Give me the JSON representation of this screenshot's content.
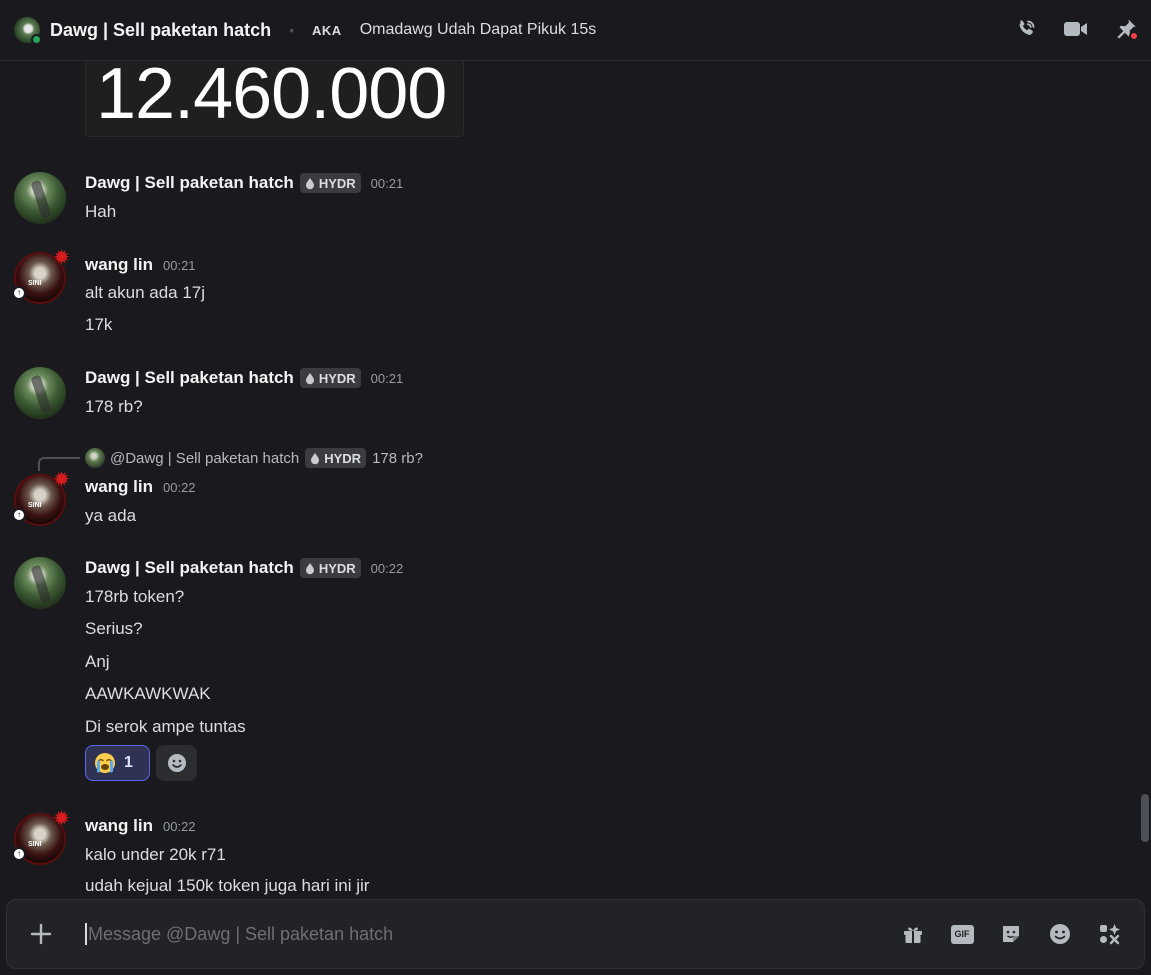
{
  "header": {
    "title": "Dawg | Sell paketan hatch",
    "separator": "•",
    "aka_label": "AKA",
    "nickname": "Omadawg Udah Dapat Pikuk 15s",
    "icons": [
      "phone-call-icon",
      "video-call-icon",
      "pin-icon"
    ]
  },
  "image_text": "12.460.000",
  "messages": [
    {
      "author": "Dawg | Sell paketan hatch",
      "tag": "HYDR",
      "time": "00:21",
      "lines": [
        "Hah"
      ]
    },
    {
      "author": "wang lin",
      "time": "00:21",
      "lines": [
        "alt akun ada 17j",
        "17k"
      ]
    },
    {
      "author": "Dawg | Sell paketan hatch",
      "tag": "HYDR",
      "time": "00:21",
      "lines": [
        "178 rb?"
      ]
    },
    {
      "author": "wang lin",
      "time": "00:22",
      "lines": [
        "ya ada"
      ],
      "reply": {
        "author": "@Dawg | Sell paketan hatch",
        "tag": "HYDR",
        "text": "178 rb?"
      }
    },
    {
      "author": "Dawg | Sell paketan hatch",
      "tag": "HYDR",
      "time": "00:22",
      "lines": [
        "178rb token?",
        "Serius?",
        "Anj",
        "AAWKAWKWAK",
        "Di serok ampe tuntas"
      ],
      "reactions": [
        {
          "emoji": "😭",
          "count": "1"
        }
      ]
    },
    {
      "author": "wang lin",
      "time": "00:22",
      "lines": [
        "kalo under 20k r71",
        "udah kejual 150k token juga hari ini jir"
      ]
    }
  ],
  "avatar_text": "SINI",
  "composer": {
    "placeholder": "Message @Dawg | Sell paketan hatch",
    "gif_label": "GIF",
    "tools": [
      "gift-icon",
      "gif-icon",
      "sticker-icon",
      "emoji-icon",
      "apps-icon"
    ]
  },
  "colors": {
    "online": "#23a55a",
    "accent": "#5865f2",
    "alert": "#f23f43"
  }
}
